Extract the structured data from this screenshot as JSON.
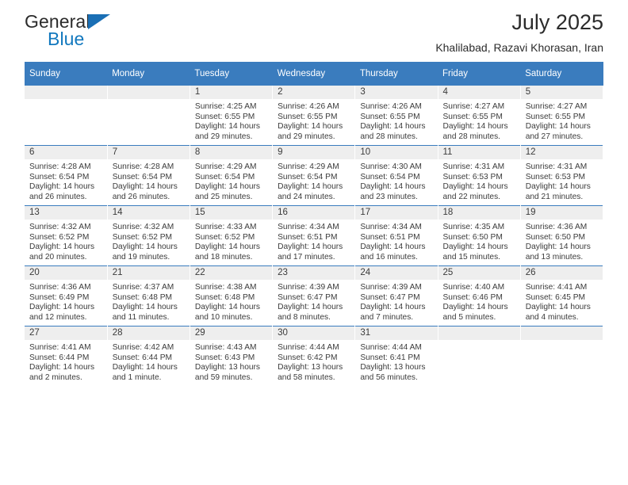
{
  "brand": {
    "name_part1": "General",
    "name_part2": "Blue",
    "triangle_color": "#1a6fb5",
    "blue_color": "#1278be"
  },
  "header": {
    "title": "July 2025",
    "subtitle": "Khalilabad, Razavi Khorasan, Iran",
    "header_bg": "#3a7cbe",
    "daynum_bg": "#eeeeee"
  },
  "weekdays": [
    "Sunday",
    "Monday",
    "Tuesday",
    "Wednesday",
    "Thursday",
    "Friday",
    "Saturday"
  ],
  "labels": {
    "sunrise": "Sunrise:",
    "sunset": "Sunset:",
    "daylight": "Daylight:"
  },
  "weeks": [
    [
      {
        "day": "",
        "sunrise": "",
        "sunset": "",
        "daylight": ""
      },
      {
        "day": "",
        "sunrise": "",
        "sunset": "",
        "daylight": ""
      },
      {
        "day": "1",
        "sunrise": "Sunrise: 4:25 AM",
        "sunset": "Sunset: 6:55 PM",
        "daylight": "Daylight: 14 hours and 29 minutes."
      },
      {
        "day": "2",
        "sunrise": "Sunrise: 4:26 AM",
        "sunset": "Sunset: 6:55 PM",
        "daylight": "Daylight: 14 hours and 29 minutes."
      },
      {
        "day": "3",
        "sunrise": "Sunrise: 4:26 AM",
        "sunset": "Sunset: 6:55 PM",
        "daylight": "Daylight: 14 hours and 28 minutes."
      },
      {
        "day": "4",
        "sunrise": "Sunrise: 4:27 AM",
        "sunset": "Sunset: 6:55 PM",
        "daylight": "Daylight: 14 hours and 28 minutes."
      },
      {
        "day": "5",
        "sunrise": "Sunrise: 4:27 AM",
        "sunset": "Sunset: 6:55 PM",
        "daylight": "Daylight: 14 hours and 27 minutes."
      }
    ],
    [
      {
        "day": "6",
        "sunrise": "Sunrise: 4:28 AM",
        "sunset": "Sunset: 6:54 PM",
        "daylight": "Daylight: 14 hours and 26 minutes."
      },
      {
        "day": "7",
        "sunrise": "Sunrise: 4:28 AM",
        "sunset": "Sunset: 6:54 PM",
        "daylight": "Daylight: 14 hours and 26 minutes."
      },
      {
        "day": "8",
        "sunrise": "Sunrise: 4:29 AM",
        "sunset": "Sunset: 6:54 PM",
        "daylight": "Daylight: 14 hours and 25 minutes."
      },
      {
        "day": "9",
        "sunrise": "Sunrise: 4:29 AM",
        "sunset": "Sunset: 6:54 PM",
        "daylight": "Daylight: 14 hours and 24 minutes."
      },
      {
        "day": "10",
        "sunrise": "Sunrise: 4:30 AM",
        "sunset": "Sunset: 6:54 PM",
        "daylight": "Daylight: 14 hours and 23 minutes."
      },
      {
        "day": "11",
        "sunrise": "Sunrise: 4:31 AM",
        "sunset": "Sunset: 6:53 PM",
        "daylight": "Daylight: 14 hours and 22 minutes."
      },
      {
        "day": "12",
        "sunrise": "Sunrise: 4:31 AM",
        "sunset": "Sunset: 6:53 PM",
        "daylight": "Daylight: 14 hours and 21 minutes."
      }
    ],
    [
      {
        "day": "13",
        "sunrise": "Sunrise: 4:32 AM",
        "sunset": "Sunset: 6:52 PM",
        "daylight": "Daylight: 14 hours and 20 minutes."
      },
      {
        "day": "14",
        "sunrise": "Sunrise: 4:32 AM",
        "sunset": "Sunset: 6:52 PM",
        "daylight": "Daylight: 14 hours and 19 minutes."
      },
      {
        "day": "15",
        "sunrise": "Sunrise: 4:33 AM",
        "sunset": "Sunset: 6:52 PM",
        "daylight": "Daylight: 14 hours and 18 minutes."
      },
      {
        "day": "16",
        "sunrise": "Sunrise: 4:34 AM",
        "sunset": "Sunset: 6:51 PM",
        "daylight": "Daylight: 14 hours and 17 minutes."
      },
      {
        "day": "17",
        "sunrise": "Sunrise: 4:34 AM",
        "sunset": "Sunset: 6:51 PM",
        "daylight": "Daylight: 14 hours and 16 minutes."
      },
      {
        "day": "18",
        "sunrise": "Sunrise: 4:35 AM",
        "sunset": "Sunset: 6:50 PM",
        "daylight": "Daylight: 14 hours and 15 minutes."
      },
      {
        "day": "19",
        "sunrise": "Sunrise: 4:36 AM",
        "sunset": "Sunset: 6:50 PM",
        "daylight": "Daylight: 14 hours and 13 minutes."
      }
    ],
    [
      {
        "day": "20",
        "sunrise": "Sunrise: 4:36 AM",
        "sunset": "Sunset: 6:49 PM",
        "daylight": "Daylight: 14 hours and 12 minutes."
      },
      {
        "day": "21",
        "sunrise": "Sunrise: 4:37 AM",
        "sunset": "Sunset: 6:48 PM",
        "daylight": "Daylight: 14 hours and 11 minutes."
      },
      {
        "day": "22",
        "sunrise": "Sunrise: 4:38 AM",
        "sunset": "Sunset: 6:48 PM",
        "daylight": "Daylight: 14 hours and 10 minutes."
      },
      {
        "day": "23",
        "sunrise": "Sunrise: 4:39 AM",
        "sunset": "Sunset: 6:47 PM",
        "daylight": "Daylight: 14 hours and 8 minutes."
      },
      {
        "day": "24",
        "sunrise": "Sunrise: 4:39 AM",
        "sunset": "Sunset: 6:47 PM",
        "daylight": "Daylight: 14 hours and 7 minutes."
      },
      {
        "day": "25",
        "sunrise": "Sunrise: 4:40 AM",
        "sunset": "Sunset: 6:46 PM",
        "daylight": "Daylight: 14 hours and 5 minutes."
      },
      {
        "day": "26",
        "sunrise": "Sunrise: 4:41 AM",
        "sunset": "Sunset: 6:45 PM",
        "daylight": "Daylight: 14 hours and 4 minutes."
      }
    ],
    [
      {
        "day": "27",
        "sunrise": "Sunrise: 4:41 AM",
        "sunset": "Sunset: 6:44 PM",
        "daylight": "Daylight: 14 hours and 2 minutes."
      },
      {
        "day": "28",
        "sunrise": "Sunrise: 4:42 AM",
        "sunset": "Sunset: 6:44 PM",
        "daylight": "Daylight: 14 hours and 1 minute."
      },
      {
        "day": "29",
        "sunrise": "Sunrise: 4:43 AM",
        "sunset": "Sunset: 6:43 PM",
        "daylight": "Daylight: 13 hours and 59 minutes."
      },
      {
        "day": "30",
        "sunrise": "Sunrise: 4:44 AM",
        "sunset": "Sunset: 6:42 PM",
        "daylight": "Daylight: 13 hours and 58 minutes."
      },
      {
        "day": "31",
        "sunrise": "Sunrise: 4:44 AM",
        "sunset": "Sunset: 6:41 PM",
        "daylight": "Daylight: 13 hours and 56 minutes."
      },
      {
        "day": "",
        "sunrise": "",
        "sunset": "",
        "daylight": ""
      },
      {
        "day": "",
        "sunrise": "",
        "sunset": "",
        "daylight": ""
      }
    ]
  ]
}
